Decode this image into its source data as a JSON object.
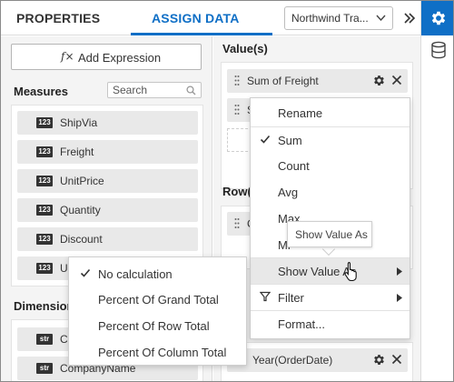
{
  "header": {
    "tab_properties": "PROPERTIES",
    "tab_assign_data": "ASSIGN DATA",
    "datasource_value": "Northwind Tra..."
  },
  "left_panel": {
    "add_expression_label": "Add Expression",
    "measures_title": "Measures",
    "search_placeholder": "Search",
    "measures": [
      {
        "badge": "123",
        "label": "ShipVia"
      },
      {
        "badge": "123",
        "label": "Freight"
      },
      {
        "badge": "123",
        "label": "UnitPrice"
      },
      {
        "badge": "123",
        "label": "Quantity"
      },
      {
        "badge": "123",
        "label": "Discount"
      },
      {
        "badge": "123",
        "label": "Uni"
      }
    ],
    "dimensions_title": "Dimension",
    "dimensions": [
      {
        "badge": "str",
        "label": "Cu"
      },
      {
        "badge": "str",
        "label": "CompanyName"
      }
    ]
  },
  "middle_panel": {
    "values_title": "Value(s)",
    "value_fields": [
      {
        "label": "Sum of Freight"
      },
      {
        "label": "S"
      }
    ],
    "rows_title": "Row(",
    "row_fields": [
      {
        "label": "C"
      }
    ],
    "bottom_field": {
      "label": "Year(OrderDate)"
    }
  },
  "context_menu": {
    "items": [
      {
        "label": "Rename",
        "checked": false
      },
      {
        "label": "Sum",
        "checked": true
      },
      {
        "label": "Count",
        "checked": false
      },
      {
        "label": "Avg",
        "checked": false
      },
      {
        "label": "Max",
        "checked": false
      },
      {
        "label": "Mi",
        "checked": false
      },
      {
        "label": "Show Value As",
        "checked": false,
        "submenu": true
      },
      {
        "label": "Filter",
        "checked": false,
        "submenu": true
      },
      {
        "label": "Format...",
        "checked": false
      }
    ]
  },
  "tooltip": {
    "text": "Show Value As"
  },
  "submenu": {
    "items": [
      {
        "label": "No calculation",
        "checked": true
      },
      {
        "label": "Percent Of Grand Total",
        "checked": false
      },
      {
        "label": "Percent Of Row Total",
        "checked": false
      },
      {
        "label": "Percent Of Column Total",
        "checked": false
      }
    ]
  },
  "colors": {
    "accent": "#0f6fc6",
    "panel_bg": "#f4f4f4",
    "field_bg": "#e9e9e9"
  },
  "icons": {
    "expand": "double-chevron-right-icon",
    "rail_settings": "gear-icon",
    "rail_datasource": "database-icon",
    "field_settings": "gear-icon",
    "field_remove": "close-icon",
    "field_drag": "drag-handle-icon",
    "search": "search-icon",
    "submenu_arrow": "caret-right-icon",
    "filter": "filter-icon",
    "check": "check-icon"
  }
}
